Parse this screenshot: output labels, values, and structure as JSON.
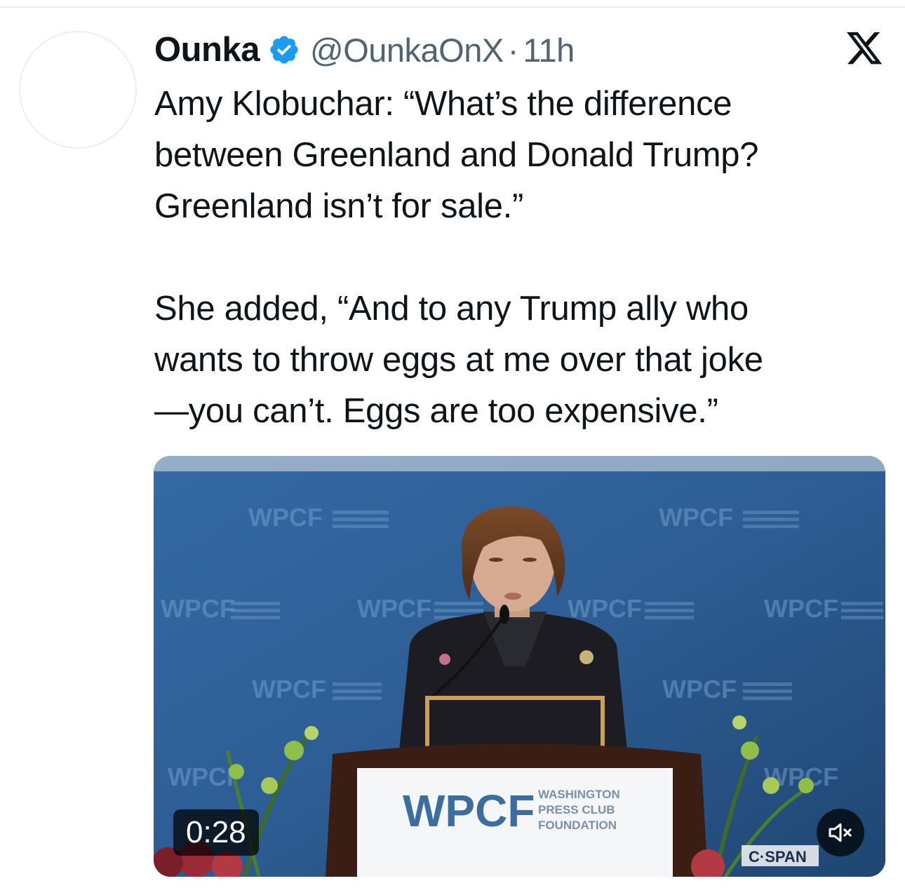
{
  "author": {
    "display_name": "Ounka",
    "handle": "@OunkaOnX",
    "separator": "·",
    "time": "11h",
    "verified": true
  },
  "icons": {
    "verified": "verified-badge-icon",
    "platform": "x-logo-icon",
    "mute": "speaker-muted-icon"
  },
  "tweet": {
    "lines_para1": [
      "Amy Klobuchar: “What’s the difference",
      "between Greenland and Donald Trump?",
      "Greenland isn’t for sale.”"
    ],
    "lines_para2": [
      "She added, “And to any Trump ally who",
      "wants to throw eggs at me over that joke",
      "—you can’t. Eggs are too expensive.”"
    ]
  },
  "video": {
    "duration": "0:28",
    "backdrop_logo": "WPCF",
    "podium_logo": "WPCF",
    "podium_org_lines": [
      "WASHINGTON",
      "PRESS CLUB",
      "FOUNDATION"
    ],
    "broadcaster": "C·SPAN"
  },
  "colors": {
    "text": "#0f1419",
    "secondary_text": "#536471",
    "verified_blue": "#1d9bf0",
    "backdrop_blue": "#2f5f95"
  }
}
